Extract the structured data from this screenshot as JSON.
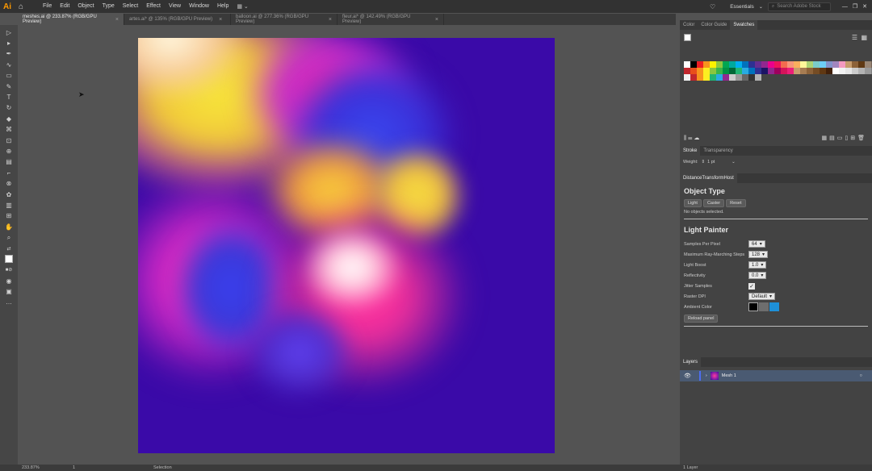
{
  "app": {
    "logo": "Ai",
    "home_icon": "home-icon"
  },
  "menu": [
    "File",
    "Edit",
    "Object",
    "Type",
    "Select",
    "Effect",
    "View",
    "Window",
    "Help"
  ],
  "workspace": {
    "label": "Essentials",
    "search_placeholder": "Search Adobe Stock"
  },
  "tabs": [
    {
      "label": "meshes.ai @ 233.87% (RGB/GPU Preview)",
      "active": true
    },
    {
      "label": "artes.ai* @ 135% (RGB/GPU Preview)",
      "active": false
    },
    {
      "label": "balloon.ai @ 277.36% (RGB/GPU Preview)",
      "active": false
    },
    {
      "label": "fleur.ai* @ 142.49% (RGB/GPU Preview)",
      "active": false
    }
  ],
  "panel_tabs": [
    "Color",
    "Color Guide",
    "Swatches"
  ],
  "swatch_colors_row1": [
    "#ffffff",
    "#000000",
    "#ed1c24",
    "#f7941d",
    "#fff200",
    "#8dc63f",
    "#00a651",
    "#00a99d",
    "#00aeef",
    "#0072bc",
    "#2e3192",
    "#662d91",
    "#92278f",
    "#ec008c",
    "#ed145b",
    "#f26c4f",
    "#f69679",
    "#fbaf5d",
    "#fff799",
    "#acd373",
    "#7accc8",
    "#6dcff6",
    "#8393ca",
    "#a186be",
    "#f49ac1",
    "#c69c6d",
    "#8c6239",
    "#603913",
    "#998675",
    "#736357",
    "#534741",
    "#c2b59b",
    "#9e8a6e"
  ],
  "swatch_colors_row2": [
    "#c1272d",
    "#e94e1b",
    "#f7931e",
    "#fcee21",
    "#8cc63f",
    "#39b54a",
    "#009245",
    "#006837",
    "#22b573",
    "#29abe2",
    "#0071bc",
    "#2e3192",
    "#1b1464",
    "#93278f",
    "#9e005d",
    "#d4145a",
    "#ed1e79",
    "#c69c6d",
    "#a67c52",
    "#8c6239",
    "#754c24",
    "#603813",
    "#42210b",
    "#ffffff",
    "#f2f2f2",
    "#e6e6e6",
    "#cccccc",
    "#b3b3b3",
    "#999999",
    "#808080",
    "#666666",
    "#4d4d4d",
    "#333333",
    "#1a1a1a",
    "#000000"
  ],
  "swatch_colors_row3": [
    "#f2f2f2",
    "#c1272d",
    "#f7931e",
    "#fcee21",
    "#22b573",
    "#29abe2",
    "#93278f",
    "#cccccc",
    "#999999",
    "#666666",
    "#333333",
    "#b3b3b3"
  ],
  "stroke_panel": {
    "tabs": [
      "Stroke",
      "Transparency"
    ],
    "weight_label": "Weight:",
    "weight_value": "1 pt"
  },
  "plugin": {
    "tab": "DistanceTransformHost",
    "object_type_heading": "Object Type",
    "buttons": [
      "Light",
      "Caster",
      "Reset"
    ],
    "no_selection": "No objects selected.",
    "light_painter_heading": "Light Painter",
    "settings": [
      {
        "label": "Samples Per Pixel",
        "value": "64"
      },
      {
        "label": "Maximum Ray-Marching Steps",
        "value": "128"
      },
      {
        "label": "Light Boost",
        "value": "1.0"
      },
      {
        "label": "Reflectivity",
        "value": "0.0"
      },
      {
        "label": "Jitter Samples",
        "value": "checked"
      },
      {
        "label": "Raster DPI",
        "value": "Default"
      },
      {
        "label": "Ambient Color",
        "value": ""
      }
    ],
    "ambient_colors": [
      "#000000",
      "#6e6e6e",
      "#1e90d8"
    ],
    "reload_button": "Reload panel"
  },
  "layers": {
    "tab": "Layers",
    "items": [
      {
        "name": "Mesh 1"
      }
    ],
    "count_label": "1 Layer"
  },
  "status": {
    "zoom": "233.87%",
    "artboard": "1",
    "tool": "Selection"
  }
}
